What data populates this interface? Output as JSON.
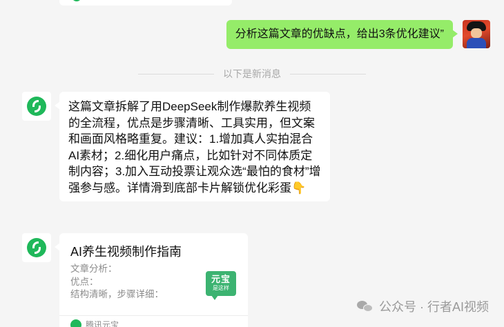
{
  "outgoing_message": {
    "text": "分析这篇文章的优缺点，给出3条优化建议”"
  },
  "divider": {
    "text": "以下是新消息"
  },
  "incoming_message": {
    "text": "这篇文章拆解了用DeepSeek制作爆款养生视频的全流程，优点是步骤清晰、工具实用，但文案和画面风格略重复。建议：1.增加真人实拍混合AI素材；2.细化用户痛点，比如针对不同体质定制内容；3.加入互动投票让观众选“最怕的食材”增强参与感。详情滑到底部卡片解锁优化彩蛋👇"
  },
  "card_message": {
    "title": "AI养生视频制作指南",
    "desc_lines": [
      "文章分析：",
      "优点：",
      "结构清晰，步骤详细："
    ],
    "thumb_line1": "元宝",
    "thumb_line2": "是这样",
    "source": "腾讯元宝"
  },
  "watermark": {
    "text": "公众号 · 行者AI视频"
  },
  "colors": {
    "outgoing_bubble": "#95ec69",
    "brand_green": "#1fb85a",
    "background": "#f5f5f5"
  },
  "icons": {
    "user_avatar": "user-avatar",
    "bot_avatar": "yuanbao-logo-icon",
    "watermark": "wechat-icon"
  }
}
